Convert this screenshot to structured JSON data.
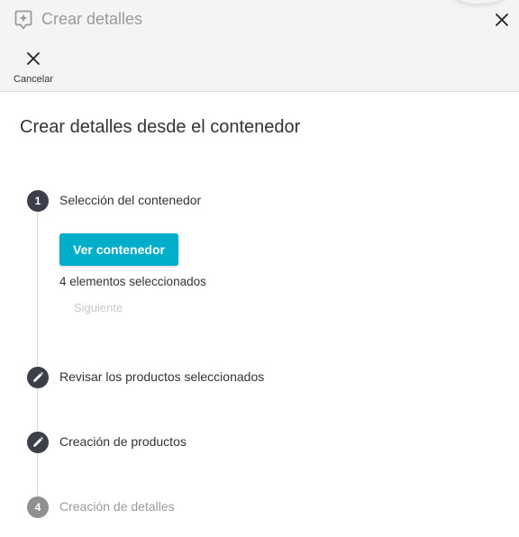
{
  "window": {
    "title": "Crear detalles",
    "app_icon": "sparkle-message-icon",
    "close_icon": "close-icon"
  },
  "toolbar": {
    "cancel_label": "Cancelar",
    "cancel_icon": "close-icon"
  },
  "page": {
    "heading": "Crear detalles desde el contenedor"
  },
  "steps": [
    {
      "marker": "1",
      "label": "Selección del contenedor",
      "state": "active"
    },
    {
      "marker": "pencil-icon",
      "label": "Revisar los productos seleccionados",
      "state": "editable"
    },
    {
      "marker": "pencil-icon",
      "label": "Creación de productos",
      "state": "editable"
    },
    {
      "marker": "4",
      "label": "Creación de detalles",
      "state": "disabled"
    }
  ],
  "step1_content": {
    "view_button_label": "Ver contenedor",
    "selected_text": "4 elementos seleccionados",
    "next_label": "Siguiente"
  },
  "colors": {
    "accent": "#00aec9",
    "step_dark": "#3b3f4a",
    "step_disabled": "#8f8f8f",
    "header_bg": "#f4f4f4"
  }
}
